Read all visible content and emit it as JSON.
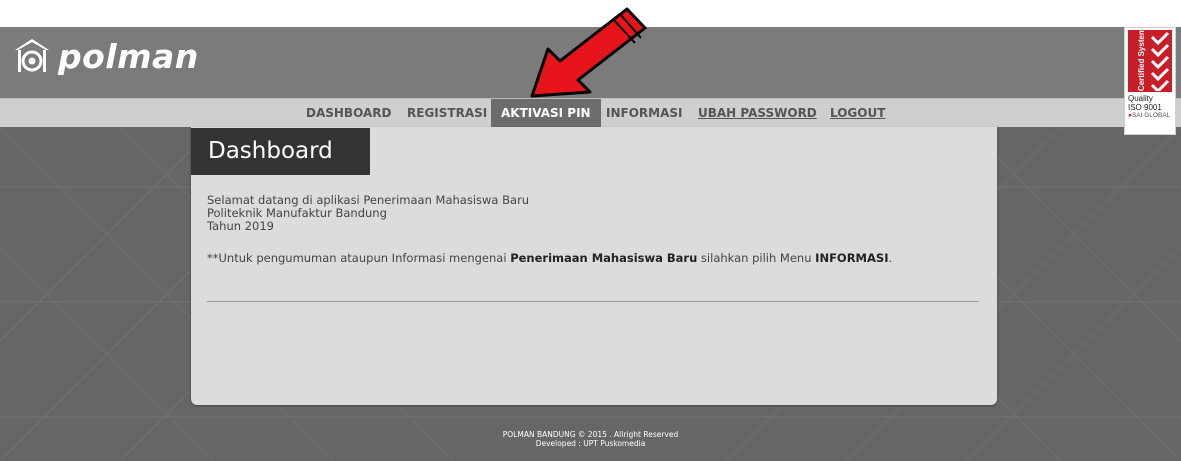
{
  "brand": {
    "logo_text": "polman",
    "logo_icon": "house-circle-icon"
  },
  "nav": {
    "items": [
      {
        "label": "DASHBOARD"
      },
      {
        "label": "REGISTRASI"
      },
      {
        "label": "AKTIVASI PIN"
      },
      {
        "label": "INFORMASI"
      },
      {
        "label": "UBAH PASSWORD"
      },
      {
        "label": "LOGOUT"
      }
    ]
  },
  "content": {
    "title": "Dashboard",
    "lines": [
      "Selamat datang di aplikasi Penerimaan Mahasiswa Baru",
      "Politeknik Manufaktur Bandung",
      "Tahun 2019"
    ],
    "note_prefix": "**Untuk pengumuman ataupun Informasi mengenai ",
    "note_bold1": "Penerimaan Mahasiswa Baru",
    "note_mid": " silahkan pilih Menu ",
    "note_bold2": "INFORMASI",
    "note_suffix": "."
  },
  "footer": {
    "line1": "POLMAN BANDUNG © 2015 . Allright Reserved",
    "line2": "Developed : UPT Puskomedia"
  },
  "iso_badge": {
    "vertical": "Certified System",
    "line1": "Quality",
    "line2": "ISO 9001",
    "line3": "SAI GLOBAL"
  },
  "colors": {
    "header_bg": "#7b7b7b",
    "nav_bg": "#cfcfcf",
    "active_tab_bg": "#6c6c6c",
    "body_bg": "#666666",
    "panel_bg": "#dcdcdc",
    "title_bg": "#333333",
    "arrow_red": "#e8141b"
  }
}
